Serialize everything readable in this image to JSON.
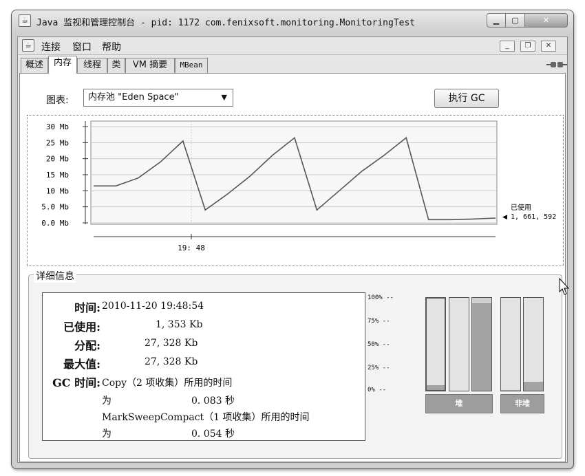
{
  "window": {
    "title": "Java 监视和管理控制台 - pid: 1172 com.fenixsoft.monitoring.MonitoringTest",
    "app_icon": "java-cup-icon"
  },
  "menu": {
    "items": [
      "连接",
      "窗口",
      "帮助"
    ]
  },
  "tabs": [
    "概述",
    "内存",
    "线程",
    "类",
    "VM 摘要",
    "MBean"
  ],
  "active_tab": "内存",
  "toolbar": {
    "chart_label": "图表:",
    "chart_select_value": "内存池 \"Eden Space\"",
    "gc_button": "执行 GC"
  },
  "plot": {
    "y_ticks": [
      "30 Mb",
      "25 Mb",
      "20 Mb",
      "15 Mb",
      "10 Mb",
      "5.0 Mb",
      "0.0 Mb"
    ],
    "x_tick": "19: 48",
    "legend_label": "已使用",
    "legend_value": "1, 661, 592"
  },
  "chart_data": {
    "type": "line",
    "ylabel": "",
    "xlabel": "",
    "ylim": [
      0,
      30
    ],
    "x_ticks": [
      "19: 48"
    ],
    "series": [
      {
        "values": [
          11.5,
          11.5,
          14,
          19,
          25.5,
          4,
          9,
          14.5,
          21,
          26.5,
          4,
          10,
          16,
          21,
          26.5,
          1,
          1,
          1.2,
          1.5
        ]
      }
    ]
  },
  "details": {
    "title": "详细信息",
    "time_label": "时间:",
    "time_value": "2010-11-20 19:48:54",
    "used_label": "已使用:",
    "used_value": "1, 353 Kb",
    "committed_label": "分配:",
    "committed_value": "27, 328 Kb",
    "max_label": "最大值:",
    "max_value": "27, 328 Kb",
    "gc_label": "GC 时间:",
    "gc_line1": "Copy（2 项收集）所用的时间",
    "gc_line2_a": "为",
    "gc_line2_b": "0. 083 秒",
    "gc_line3": "MarkSweepCompact（1 项收集）所用的时间",
    "gc_line4_a": "为",
    "gc_line4_b": "0. 054 秒"
  },
  "pool_bars": {
    "pct_labels": [
      "100% --",
      "75% --",
      "50% --",
      "25% --",
      "0% --"
    ],
    "heap_label": "堆",
    "nonheap_label": "非堆",
    "levels": [
      0.05,
      0.0,
      0.95,
      0.01,
      0.1
    ]
  }
}
